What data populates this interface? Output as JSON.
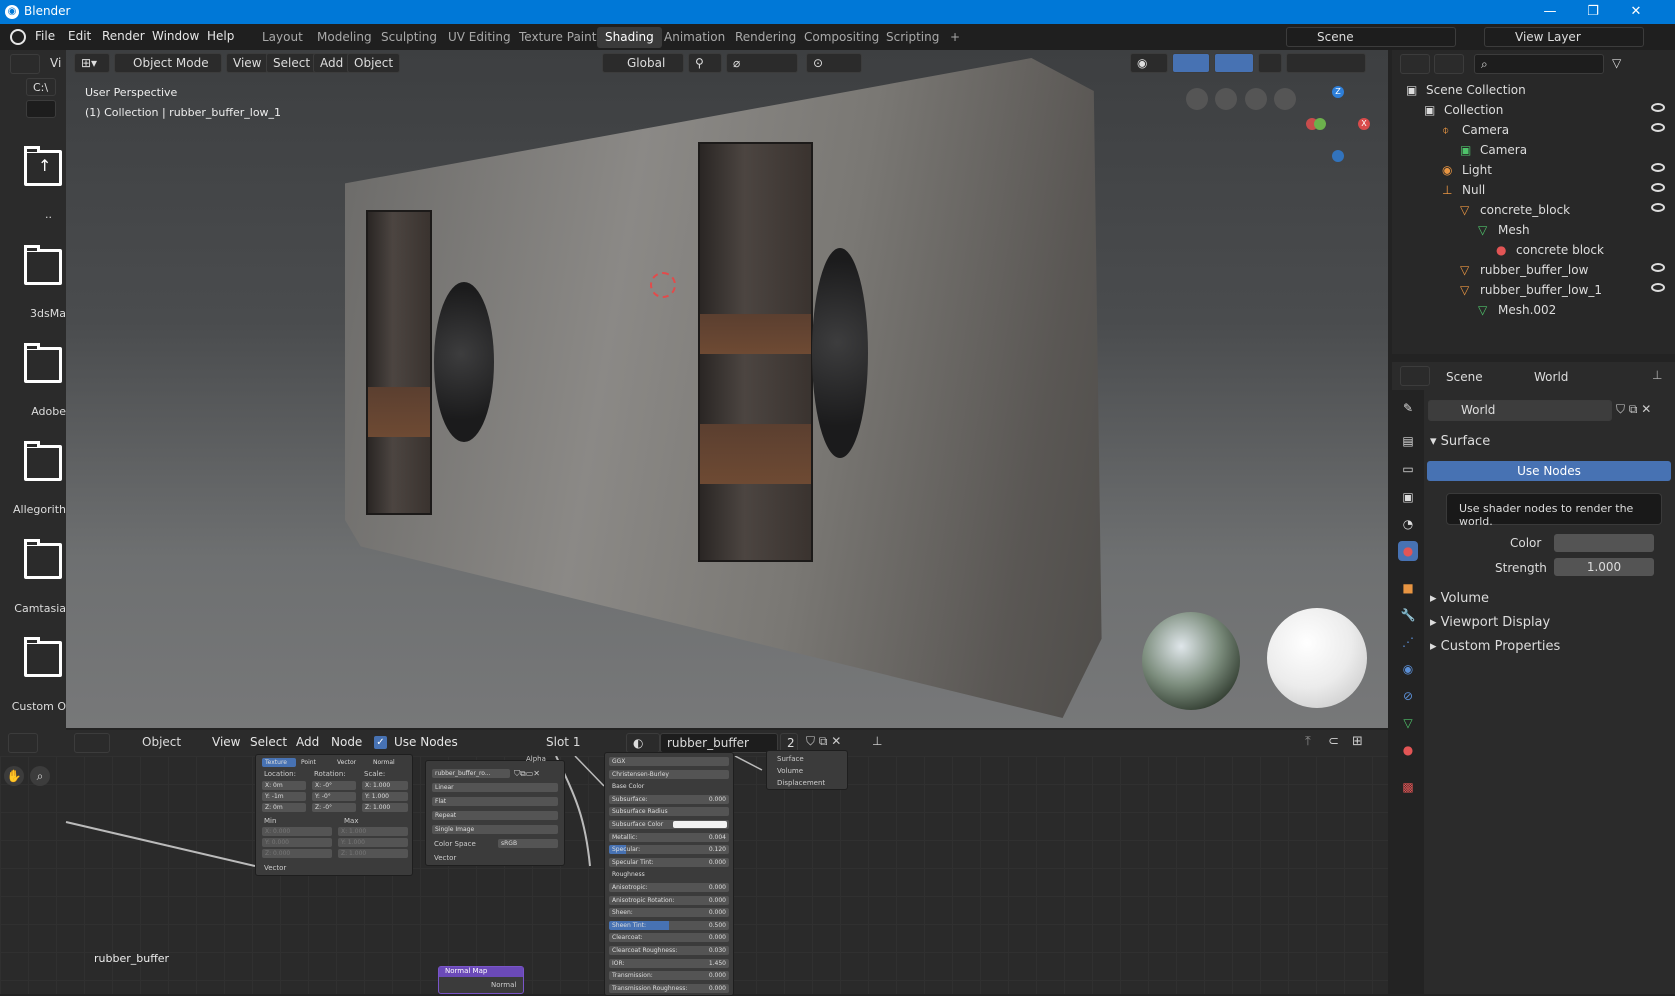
{
  "window": {
    "title": "Blender"
  },
  "menu": {
    "items": [
      "File",
      "Edit",
      "Render",
      "Window",
      "Help"
    ]
  },
  "workspaces": [
    "Layout",
    "Modeling",
    "Sculpting",
    "UV Editing",
    "Texture Paint",
    "Shading",
    "Animation",
    "Rendering",
    "Compositing",
    "Scripting",
    "+"
  ],
  "active_workspace": "Shading",
  "scene_name": "Scene",
  "view_layer": "View Layer",
  "left_browser": {
    "vi": "Vi",
    "path": "C:\\",
    "up": "..",
    "folders": [
      "3dsMa",
      "Adobe",
      "Allegorith",
      "Camtasia",
      "Custom O"
    ]
  },
  "viewport": {
    "mode": "Object Mode",
    "menus": [
      "View",
      "Select",
      "Add",
      "Object"
    ],
    "orientation": "Global",
    "perspective": "User Perspective",
    "collection_info": "(1) Collection | rubber_buffer_low_1",
    "gizmo": {
      "z": "Z",
      "x": "X"
    }
  },
  "outliner": {
    "items": [
      {
        "label": "Scene Collection",
        "indent": 0
      },
      {
        "label": "Collection",
        "indent": 1
      },
      {
        "label": "Camera",
        "indent": 2
      },
      {
        "label": "Camera",
        "indent": 3
      },
      {
        "label": "Light",
        "indent": 2
      },
      {
        "label": "Null",
        "indent": 2
      },
      {
        "label": "concrete_block",
        "indent": 3
      },
      {
        "label": "Mesh",
        "indent": 4
      },
      {
        "label": "concrete block",
        "indent": 5
      },
      {
        "label": "rubber_buffer_low",
        "indent": 3
      },
      {
        "label": "rubber_buffer_low_1",
        "indent": 3
      },
      {
        "label": "Mesh.002",
        "indent": 4
      }
    ]
  },
  "properties": {
    "breadcrumb_scene": "Scene",
    "breadcrumb_world": "World",
    "world_name": "World",
    "surface_label": "Surface",
    "use_nodes_label": "Use Nodes",
    "tooltip": "Use shader nodes to render the world.",
    "color_label": "Color",
    "strength_label": "Strength",
    "strength_value": "1.000",
    "panels": [
      "Volume",
      "Viewport Display",
      "Custom Properties"
    ]
  },
  "node_editor": {
    "mode": "Object",
    "menus": [
      "View",
      "Select",
      "Add",
      "Node"
    ],
    "use_nodes": "Use Nodes",
    "slot": "Slot 1",
    "material": "rubber_buffer",
    "users": "2",
    "material_label": "rubber_buffer",
    "mapping_node": {
      "tabs": [
        "Texture",
        "Point",
        "Vector",
        "Normal"
      ],
      "location": "Location:",
      "rotation": "Rotation:",
      "scale": "Scale:",
      "loc": [
        "X: 0m",
        "Y: -1m",
        "Z: 0m"
      ],
      "rot": [
        "X: -0°",
        "Y: -0°",
        "Z: -0°"
      ],
      "scl": [
        "X: 1.000",
        "Y: 1.000",
        "Z: 1.000"
      ],
      "min": "Min",
      "max": "Max",
      "zeros": [
        "X: 0.000",
        "Y: 0.000",
        "Z: 0.000"
      ],
      "ones": [
        "X: 1.000",
        "Y: 1.000",
        "Z: 1.000"
      ],
      "vector": "Vector"
    },
    "image_node": {
      "name": "rubber_buffer_ro...",
      "linear": "Linear",
      "flat": "Flat",
      "repeat": "Repeat",
      "single": "Single Image",
      "colorspace_label": "Color Space",
      "colorspace": "sRGB",
      "vector": "Vector",
      "alpha": "Alpha"
    },
    "bsdf_node": {
      "rows": [
        [
          "GGX",
          ""
        ],
        [
          "Christensen-Burley",
          ""
        ],
        [
          "Base Color",
          ""
        ],
        [
          "Subsurface:",
          "0.000"
        ],
        [
          "Subsurface Radius",
          ""
        ],
        [
          "Subsurface Color",
          ""
        ],
        [
          "Metallic:",
          "0.004"
        ],
        [
          "Specular:",
          "0.120"
        ],
        [
          "Specular Tint:",
          "0.000"
        ],
        [
          "Roughness",
          ""
        ],
        [
          "Anisotropic:",
          "0.000"
        ],
        [
          "Anisotropic Rotation:",
          "0.000"
        ],
        [
          "Sheen:",
          "0.000"
        ],
        [
          "Sheen Tint:",
          "0.500"
        ],
        [
          "Clearcoat:",
          "0.000"
        ],
        [
          "Clearcoat Roughness:",
          "0.030"
        ],
        [
          "IOR:",
          "1.450"
        ],
        [
          "Transmission:",
          "0.000"
        ],
        [
          "Transmission Roughness:",
          "0.000"
        ]
      ]
    },
    "output_node": {
      "rows": [
        "Surface",
        "Volume",
        "Displacement"
      ]
    },
    "normalmap_node": {
      "title": "Normal Map",
      "normal": "Normal"
    }
  },
  "colors": {
    "title_bar": "#0078d7",
    "accent_blue": "#4772b3",
    "orange": "#e89542"
  }
}
